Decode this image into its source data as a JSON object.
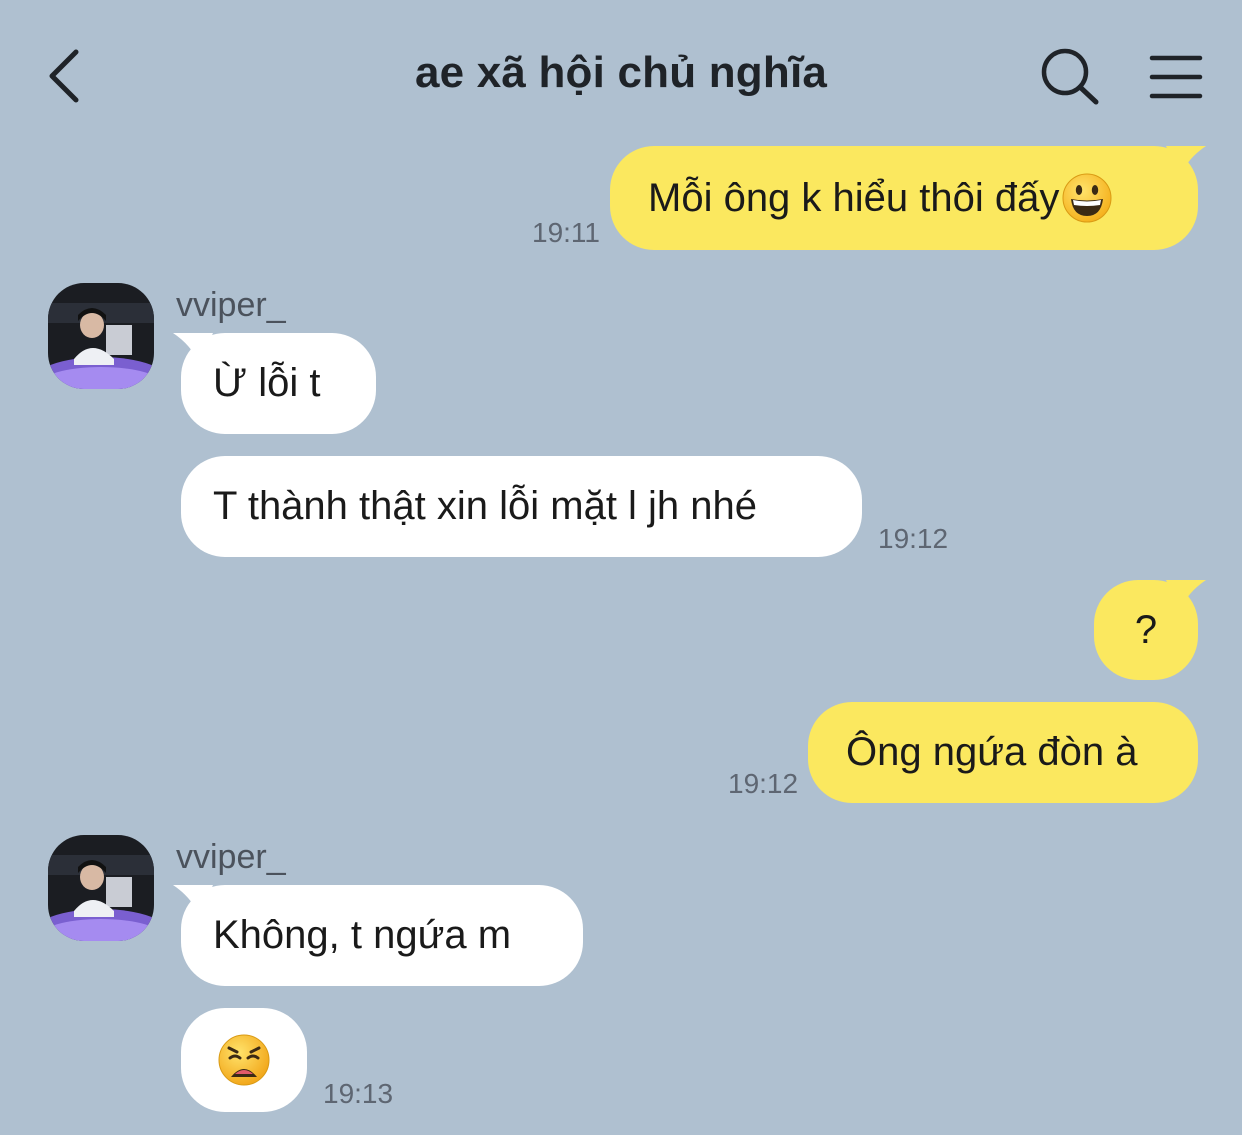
{
  "header": {
    "title": "ae xã hội chủ nghĩa"
  },
  "icons": {
    "back": "chevron-left-icon",
    "search": "search-icon",
    "menu": "hamburger-menu-icon"
  },
  "colors": {
    "background": "#afc0d0",
    "my_bubble": "#fbe85f",
    "their_bubble": "#ffffff",
    "text": "#1a1a1a",
    "time": "#5e6672"
  },
  "messages": [
    {
      "text": "Mỗi ông k hiểu thôi đấy",
      "emoji": "grinning-face",
      "time": "19:11"
    },
    {
      "sender": "vviper_",
      "text": "Ừ lỗi t"
    },
    {
      "text": "T thành thật xin lỗi mặt l jh nhé",
      "time": "19:12"
    },
    {
      "text": "?"
    },
    {
      "text": "Ông ngứa đòn à",
      "time": "19:12"
    },
    {
      "sender": "vviper_",
      "text": "Không, t ngứa m"
    },
    {
      "emoji": "weary-face",
      "time": "19:13"
    }
  ]
}
